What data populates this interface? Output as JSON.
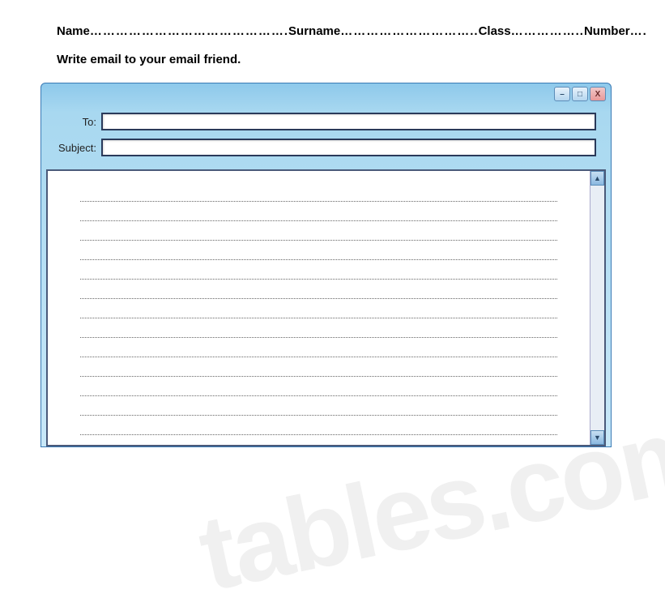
{
  "header": {
    "name_label": "Name",
    "name_dots": "……………………………………….",
    "surname_label": "Surname",
    "surname_dots": "…………………………..",
    "class_label": "Class",
    "class_dots": "……………..",
    "number_label": "Number",
    "number_dots": "…."
  },
  "instruction": "Write email to your email friend.",
  "email": {
    "to_label": "To:",
    "subject_label": "Subject:",
    "to_value": "",
    "subject_value": ""
  },
  "window_controls": {
    "minimize": "–",
    "maximize": "□",
    "close": "X"
  },
  "scroll": {
    "up": "▲",
    "down": "▼"
  },
  "writing_lines_count": 13,
  "watermark": "tables.com"
}
